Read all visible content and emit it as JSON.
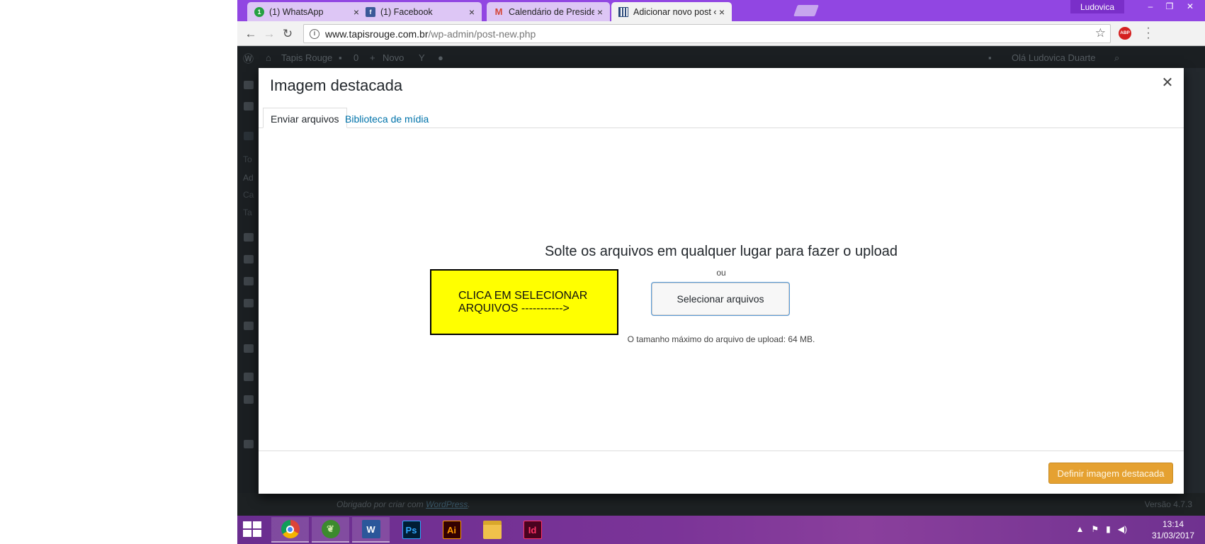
{
  "browser": {
    "tabs": [
      {
        "title": "(1) WhatsApp",
        "icon": "whatsapp-icon",
        "active": false
      },
      {
        "title": "(1) Facebook",
        "icon": "facebook-icon",
        "active": false
      },
      {
        "title": "Calendário de Presidenci",
        "icon": "gmail-icon",
        "active": false
      },
      {
        "title": "Adicionar novo post ‹ Ta",
        "icon": "wordpress-page-icon",
        "active": true
      }
    ],
    "profile_name": "Ludovica",
    "url_host": "www.tapisrouge.com.br",
    "url_path": "/wp-admin/post-new.php",
    "abp_label": "ABP"
  },
  "admin_bar": {
    "site_name": "Tapis Rouge",
    "comments_count": "0",
    "new_label": "Novo",
    "greeting": "Olá Ludovica Duarte"
  },
  "sidebar_fragments": [
    "To",
    "Ad",
    "Ca",
    "Ta"
  ],
  "footer": {
    "thanks_prefix": "Obrigado por criar com",
    "thanks_link": "WordPress",
    "version": "Versão 4.7.3"
  },
  "modal": {
    "title": "Imagem destacada",
    "tabs": [
      "Enviar arquivos",
      "Biblioteca de mídia"
    ],
    "drop_text": "Solte os arquivos em qualquer lugar para fazer o upload",
    "or_text": "ou",
    "select_button": "Selecionar arquivos",
    "max_size_text": "O tamanho máximo do arquivo de upload: 64 MB.",
    "define_button": "Definir imagem destacada"
  },
  "annotation": {
    "line1": "CLICA EM SELECIONAR",
    "line2": "ARQUIVOS ----------->"
  },
  "taskbar": {
    "apps": [
      {
        "name": "chrome",
        "label": ""
      },
      {
        "name": "corel",
        "label": ""
      },
      {
        "name": "word",
        "label": "W"
      },
      {
        "name": "photoshop",
        "label": "Ps"
      },
      {
        "name": "illustrator",
        "label": "Ai"
      },
      {
        "name": "file-explorer",
        "label": ""
      },
      {
        "name": "indesign",
        "label": "Id"
      }
    ],
    "time": "13:14",
    "date": "31/03/2017"
  },
  "colors": {
    "tabstrip": "#9146e2",
    "wp_primary_button": "#e5a131",
    "link": "#0073aa",
    "annotation_bg": "#ffff00"
  }
}
